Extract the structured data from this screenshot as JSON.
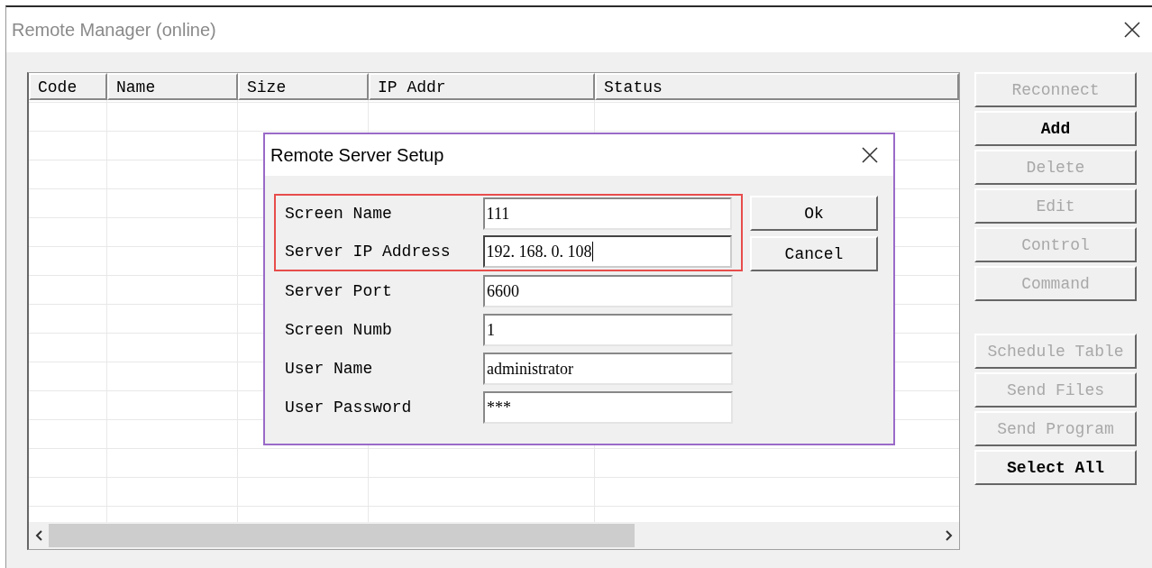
{
  "window": {
    "title": "Remote Manager (online)"
  },
  "table": {
    "columns": [
      "Code",
      "Name",
      "Size",
      "IP Addr",
      "Status"
    ]
  },
  "button_groups": [
    [
      {
        "label": "Reconnect",
        "disabled": true
      },
      {
        "label": "Add",
        "disabled": false
      },
      {
        "label": "Delete",
        "disabled": true
      },
      {
        "label": "Edit",
        "disabled": true
      },
      {
        "label": "Control",
        "disabled": true
      },
      {
        "label": "Command",
        "disabled": true
      }
    ],
    [
      {
        "label": "Schedule Table",
        "disabled": true
      },
      {
        "label": "Send Files",
        "disabled": true
      },
      {
        "label": "Send Program",
        "disabled": true
      },
      {
        "label": "Select All",
        "disabled": false
      }
    ]
  ],
  "dialog": {
    "title": "Remote Server Setup",
    "fields": [
      {
        "label": "Screen Name",
        "value": "111",
        "highlighted": true,
        "focused": false
      },
      {
        "label": "Server IP Address",
        "value": "192. 168. 0. 108",
        "highlighted": true,
        "focused": true
      },
      {
        "label": "Server Port",
        "value": "6600",
        "highlighted": false,
        "focused": false
      },
      {
        "label": "Screen Numb",
        "value": "1",
        "highlighted": false,
        "focused": false
      },
      {
        "label": "User Name",
        "value": "administrator",
        "highlighted": false,
        "focused": false
      },
      {
        "label": "User Password",
        "value": "***",
        "highlighted": false,
        "focused": false
      }
    ],
    "buttons": [
      "Ok",
      "Cancel"
    ]
  }
}
